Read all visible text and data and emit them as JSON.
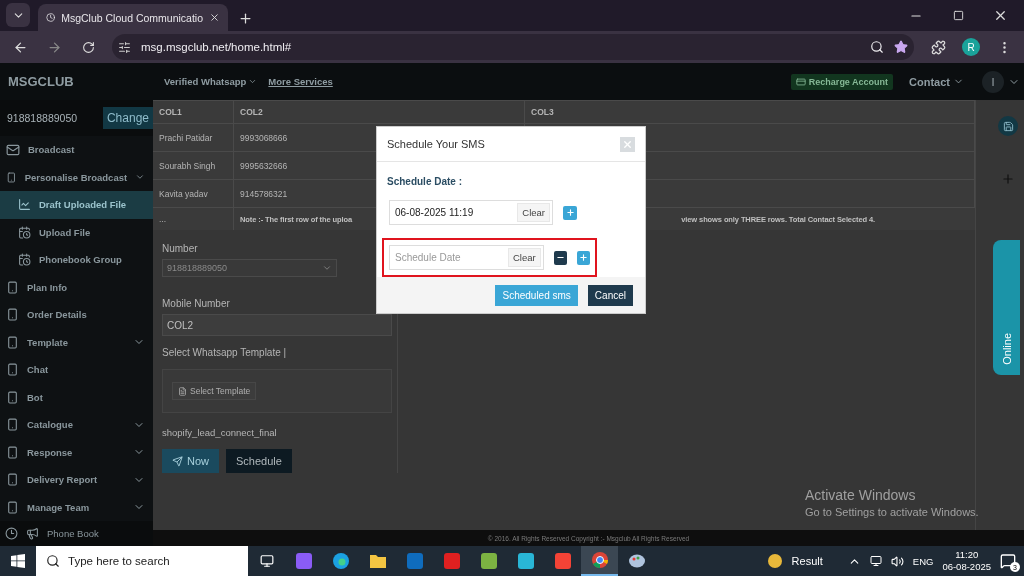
{
  "browser": {
    "tab_title": "MsgClub Cloud Communicatio",
    "url": "msg.msgclub.net/home.html#",
    "profile": "R"
  },
  "header": {
    "logo": "MSGCLUB",
    "nav": [
      "Verified Whatsapp",
      "More Services"
    ],
    "recharge": "Recharge Account",
    "contact": "Contact",
    "avatar": "I"
  },
  "sidebar": {
    "number": "918818889050",
    "change": "Change",
    "items": [
      {
        "label": "Broadcast",
        "kind": "link",
        "selected": false
      },
      {
        "label": "Personalise Broadcast",
        "kind": "group",
        "selected": false,
        "children": [
          {
            "label": "Draft Uploaded File",
            "kind": "sub",
            "selected": true
          },
          {
            "label": "Upload File",
            "kind": "sub",
            "selected": false
          },
          {
            "label": "Phonebook Group",
            "kind": "sub",
            "selected": false
          }
        ]
      },
      {
        "label": "Plan Info",
        "kind": "link",
        "selected": false
      },
      {
        "label": "Order Details",
        "kind": "link",
        "selected": false
      },
      {
        "label": "Template",
        "kind": "group",
        "selected": false
      },
      {
        "label": "Chat",
        "kind": "link",
        "selected": false
      },
      {
        "label": "Bot",
        "kind": "link",
        "selected": false
      },
      {
        "label": "Catalogue",
        "kind": "group",
        "selected": false
      },
      {
        "label": "Response",
        "kind": "group",
        "selected": false
      },
      {
        "label": "Delivery Report",
        "kind": "group",
        "selected": false
      },
      {
        "label": "Manage Team",
        "kind": "group",
        "selected": false
      }
    ],
    "bottom_label": "Phone Book"
  },
  "table": {
    "columns": [
      "COL1",
      "COL2",
      "COL3"
    ],
    "rows": [
      [
        "Prachi Patidar",
        "9993068666"
      ],
      [
        "Sourabh Singh",
        "9995632666"
      ],
      [
        "Kavita yadav",
        "9145786321"
      ]
    ],
    "note_row": {
      "column_1": "...",
      "note_start": "Note :- The first row of the uploa",
      "note_end": "view shows only THREE rows. Total Contact Selected 4."
    }
  },
  "form": {
    "number_label": "Number",
    "number_value": "918818889050",
    "number_disabled": true,
    "mobile_label": "Mobile Number",
    "mobile_value": "COL2",
    "template_label": "Select Whatsapp Template |",
    "template_button": "Select Template",
    "template_name": "shopify_lead_connect_final",
    "now_button": "Now",
    "schedule_button": "Schedule"
  },
  "side_tab": "Online",
  "footer": "© 2016. All Rights Reserved Copyright :- Msgclub All Rights Reserved",
  "modal": {
    "title": "Schedule Your SMS",
    "date_label": "Schedule Date :",
    "rows": [
      {
        "value": "06-08-2025 11:19",
        "clear": "Clear",
        "removable": false,
        "highlighted": false
      },
      {
        "placeholder": "Schedule Date",
        "clear": "Clear",
        "removable": true,
        "highlighted": true
      }
    ],
    "buttons": [
      "Scheduled sms",
      "Cancel"
    ]
  },
  "activation": {
    "title": "Activate Windows",
    "subtitle": "Go to Settings to activate Windows."
  },
  "taskbar": {
    "search_placeholder": "Type here to search",
    "weather": "Result",
    "language": "ENG",
    "time": "11:20",
    "date": "06-08-2025",
    "notifications": "3"
  }
}
